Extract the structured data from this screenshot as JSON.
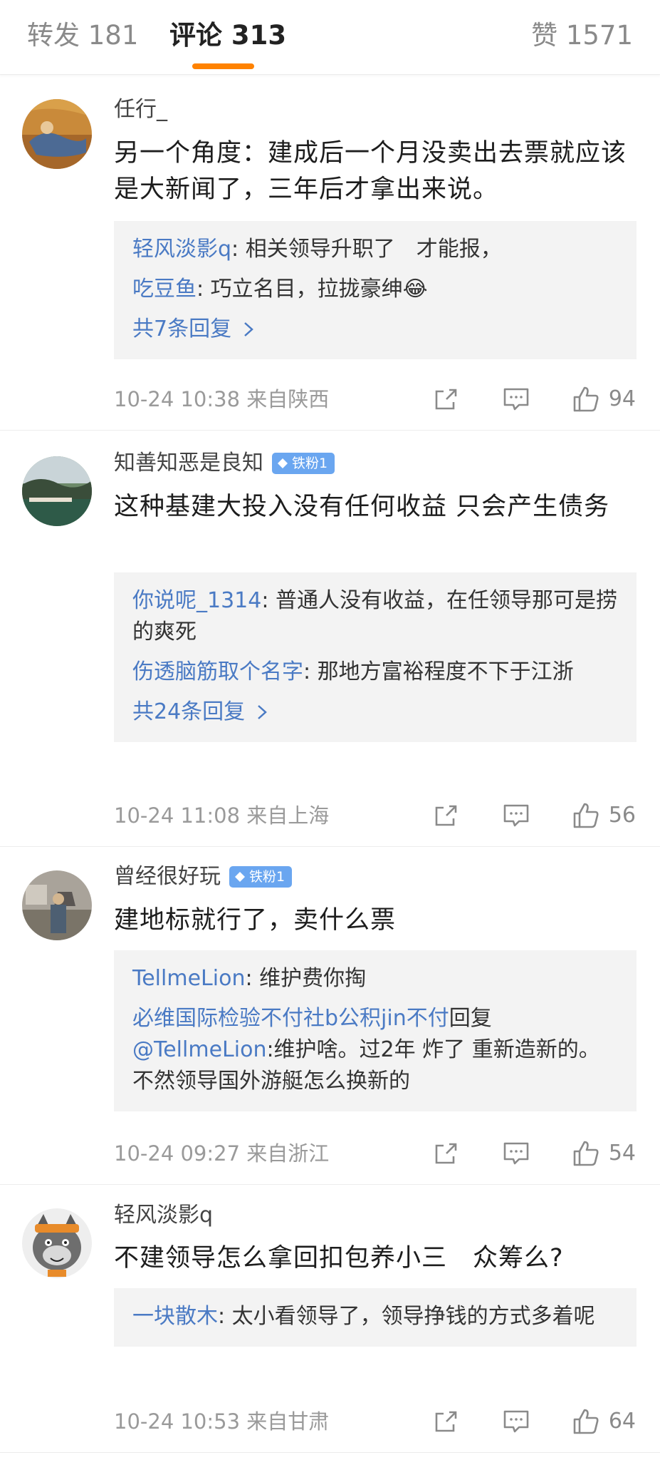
{
  "tabs": {
    "repost": "转发 181",
    "comments": "评论 313",
    "likes": "赞 1571"
  },
  "accent_color": "#ff8200",
  "link_color": "#4a7ac4",
  "comments": [
    {
      "username": "任行_",
      "badge": "",
      "text": "另一个角度：建成后一个月没卖出去票就应该是大新闻了，三年后才拿出来说。",
      "replies": [
        {
          "name": "轻风淡影q",
          "text": ": 相关领导升职了　才能报，"
        },
        {
          "name": "吃豆鱼",
          "text": ": 巧立名目，拉拢豪绅😂"
        }
      ],
      "more": "共7条回复",
      "meta": "10-24 10:38  来自陕西",
      "likes": "94",
      "icons": [
        "repost-icon",
        "comment-icon",
        "like-icon"
      ]
    },
    {
      "username": "知善知恶是良知",
      "badge": "铁粉1",
      "text": "这种基建大投入没有任何收益 只会产生债务",
      "replies": [
        {
          "name": "你说呢_1314",
          "text": ": 普通人没有收益，在任领导那可是捞的爽死"
        },
        {
          "name": "伤透脑筋取个名字",
          "text": ": 那地方富裕程度不下于江浙"
        }
      ],
      "more": "共24条回复",
      "meta": "10-24 11:08  来自上海",
      "likes": "56"
    },
    {
      "username": "曾经很好玩",
      "badge": "铁粉1",
      "text": "建地标就行了，卖什么票",
      "replies": [
        {
          "name": "TellmeLion",
          "text": ": 维护费你掏"
        },
        {
          "name": "必维国际检验不付社b公积jin不付",
          "text": "回复",
          "mention": "@TellmeLion",
          "tail": ":维护啥。过2年 炸了 重新造新的。不然领导国外游艇怎么换新的"
        }
      ],
      "more": "",
      "meta": "10-24 09:27  来自浙江",
      "likes": "54"
    },
    {
      "username": "轻风淡影q",
      "badge": "",
      "text": "不建领导怎么拿回扣包养小三　众筹么?",
      "replies": [
        {
          "name": "一块散木",
          "text": ": 太小看领导了，领导挣钱的方式多着呢"
        }
      ],
      "more": "",
      "meta": "10-24 10:53  来自甘肃",
      "likes": "64"
    }
  ]
}
